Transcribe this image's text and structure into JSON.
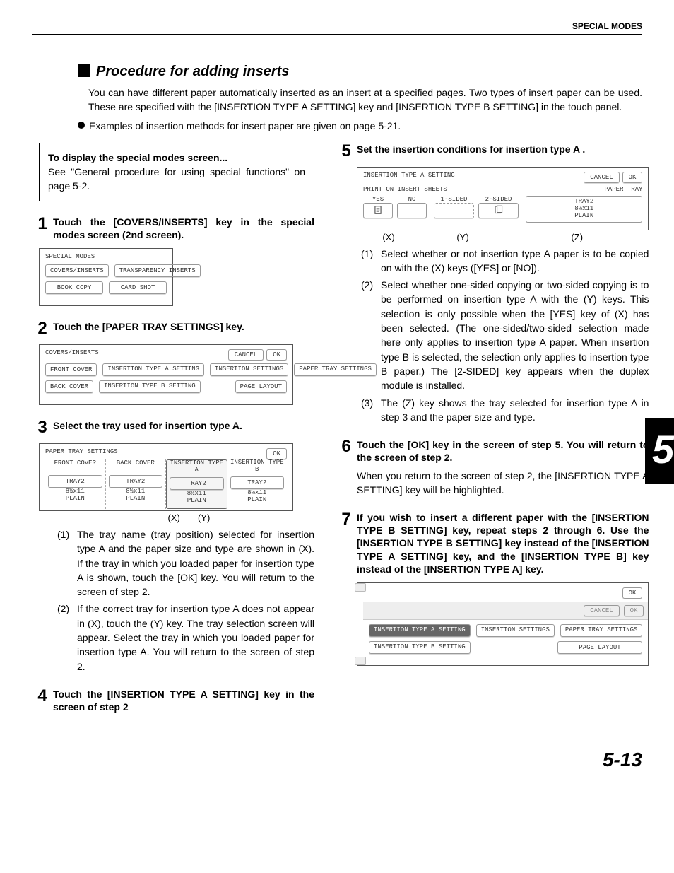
{
  "header": {
    "section": "SPECIAL MODES"
  },
  "title": "Procedure for adding inserts",
  "intro1": "You can have different paper automatically inserted as an insert at a specified pages. Two types of insert paper can be used. These are specified with the [INSERTION TYPE A SETTING] key and [INSERTION TYPE B SETTING] in the touch panel.",
  "intro2": "Examples of insertion methods for insert paper are given on page 5-21.",
  "note": {
    "title": "To display the special modes screen...",
    "body": "See \"General procedure for using special functions\" on page 5-2."
  },
  "steps": {
    "s1": "Touch the [COVERS/INSERTS] key in the special modes screen (2nd screen).",
    "s2": "Touch the [PAPER TRAY SETTINGS] key.",
    "s3": "Select the tray used for insertion type A.",
    "s3_li1": "The tray name (tray position) selected for insertion type A and the paper size and type are shown in  (X).  If the tray in which  you loaded paper for insertion type A is shown, touch the [OK] key. You will return to the screen of step 2.",
    "s3_li2": "If the correct tray for insertion type A does not appear in (X), touch the (Y) key. The tray selection screen will appear. Select the tray in which you loaded paper for insertion type A. You will return to the screen of step 2.",
    "s4": "Touch the [INSERTION TYPE A SETTING] key in the screen of step 2",
    "s5": "Set the insertion conditions for insertion type A .",
    "s5_li1": "Select whether or not insertion type A paper is to be copied on with the (X) keys ([YES] or [NO]).",
    "s5_li2": "Select whether one-sided copying or two-sided copying is to be performed on insertion type A with the (Y) keys. This selection is only possible when the [YES] key of  (X) has been selected. (The one-sided/two-sided selection made here only applies to insertion type A paper. When insertion type B is selected, the selection only applies to insertion type B paper.) The [2-SIDED] key appears when the duplex module is installed.",
    "s5_li3": "The (Z) key shows the tray selected for insertion type A in step 3 and the paper size and type.",
    "s6": "Touch the [OK] key in the screen of step 5. You will return to the screen of step 2.",
    "s6_body": "When you return to the screen of step 2, the [INSERTION TYPE A SETTING] key will be highlighted.",
    "s7": "If you wish to insert a different paper with the [INSERTION TYPE B SETTING] key, repeat steps 2 through 6. Use the [INSERTION TYPE B SETTING] key instead of the [INSERTION TYPE A SETTING] key, and the [INSERTION TYPE B] key instead of the [INSERTION TYPE A] key."
  },
  "ui1": {
    "title": "SPECIAL MODES",
    "b1": "COVERS/INSERTS",
    "b2": "TRANSPARENCY INSERTS",
    "b3": "BOOK COPY",
    "b4": "CARD SHOT"
  },
  "ui2": {
    "title": "COVERS/INSERTS",
    "cancel": "CANCEL",
    "ok": "OK",
    "fc": "FRONT COVER",
    "bc": "BACK COVER",
    "ia": "INSERTION TYPE A SETTING",
    "ib": "INSERTION TYPE B SETTING",
    "is": "INSERTION SETTINGS",
    "pt": "PAPER TRAY SETTINGS",
    "pl": "PAGE LAYOUT"
  },
  "ui3": {
    "title": "PAPER TRAY SETTINGS",
    "ok": "OK",
    "h1": "FRONT COVER",
    "h2": "BACK COVER",
    "h3": "INSERTION TYPE A",
    "h4": "INSERTION TYPE B",
    "tray": "TRAY2",
    "size": "8½x11",
    "type": "PLAIN",
    "ax": "(X)",
    "ay": "(Y)"
  },
  "ui5": {
    "title": "INSERTION TYPE A SETTING",
    "cancel": "CANCEL",
    "ok": "OK",
    "printon": "PRINT ON INSERT SHEETS",
    "papertray": "PAPER TRAY",
    "yes": "YES",
    "no": "NO",
    "s1": "1-SIDED",
    "s2": "2-SIDED",
    "tray": "TRAY2",
    "size": "8½x11",
    "type": "PLAIN",
    "ax": "(X)",
    "ay": "(Y)",
    "az": "(Z)"
  },
  "ui7": {
    "ok": "OK",
    "cancel": "CANCEL",
    "ia": "INSERTION TYPE A SETTING",
    "ib": "INSERTION TYPE B SETTING",
    "is": "INSERTION SETTINGS",
    "pt": "PAPER TRAY SETTINGS",
    "pl": "PAGE LAYOUT"
  },
  "pageNum": "5-13",
  "sideTab": "5"
}
